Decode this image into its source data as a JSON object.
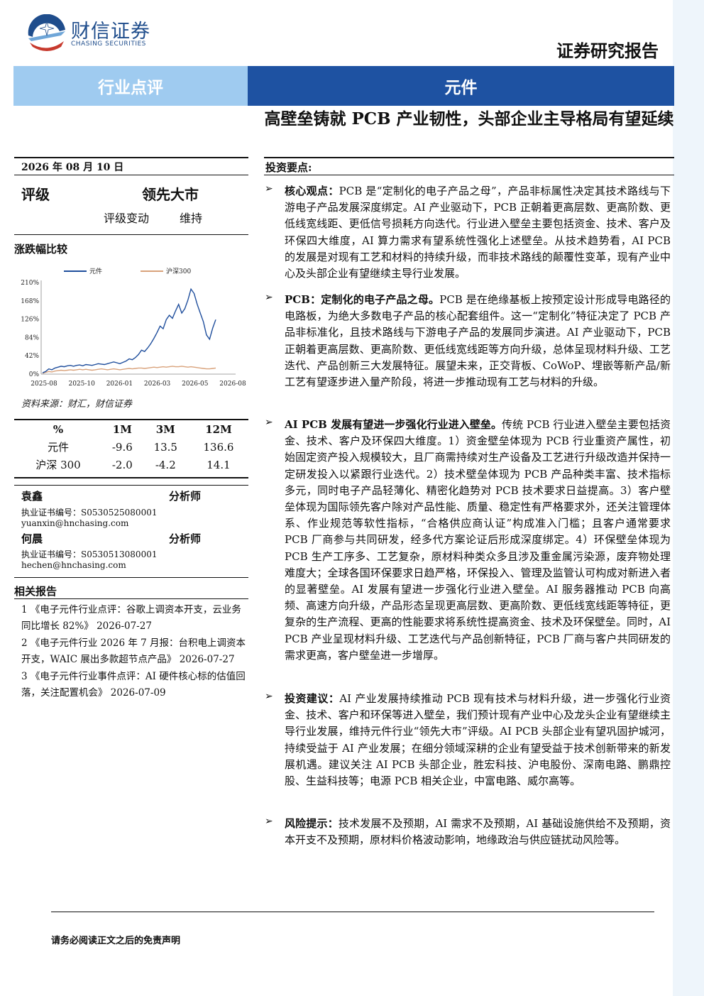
{
  "header": {
    "company_cn": "财信证券",
    "company_en": "CHASING SECURITIES",
    "report_type": "证券研究报告"
  },
  "banner": {
    "category": "行业点评",
    "industry": "元件"
  },
  "title": "高壁垒铸就 PCB 产业韧性，头部企业主导格局有望延续",
  "sidebar": {
    "date": "2026 年 08 月 10 日",
    "rating_label": "评级",
    "rating_value": "领先大市",
    "rating_change_label": "评级变动",
    "rating_change_value": "维持",
    "compare_title": "涨跌幅比较",
    "source": "资料来源：财汇，财信证券",
    "perf_table": {
      "headers": [
        "%",
        "1M",
        "3M",
        "12M"
      ],
      "rows": [
        [
          "元件",
          "-9.6",
          "13.5",
          "136.6"
        ],
        [
          "沪深 300",
          "-2.0",
          "-4.2",
          "14.1"
        ]
      ]
    },
    "analysts": [
      {
        "name": "袁鑫",
        "role": "分析师",
        "cert": "执业证书编号：S0530525080001",
        "email": "yuanxin@hnchasing.com"
      },
      {
        "name": "何晨",
        "role": "分析师",
        "cert": "执业证书编号：S0530513080001",
        "email": "hechen@hnchasing.com"
      }
    ],
    "related_title": "相关报告",
    "related": [
      "1 《电子元件行业点评：谷歌上调资本开支，云业务同比增长 82%》 2026-07-27",
      "2 《电子元件行业 2026 年 7 月报：台积电上调资本开支，WAIC 展出多款超节点产品》 2026-07-27",
      "3 《电子元件行业事件点评：AI 硬件核心标的估值回落，关注配置机会》 2026-07-09"
    ]
  },
  "chart_data": {
    "type": "line",
    "x_ticks": [
      "2025-08",
      "2025-10",
      "2026-01",
      "2026-03",
      "2026-05",
      "2026-08"
    ],
    "y_ticks": [
      "0%",
      "42%",
      "84%",
      "126%",
      "168%",
      "210%"
    ],
    "ylim": [
      0,
      210
    ],
    "grid": false,
    "legend_position": "top",
    "series": [
      {
        "name": "元件",
        "color": "#1f4e9c",
        "values": [
          3,
          6,
          12,
          10,
          14,
          16,
          18,
          17,
          19,
          20,
          18,
          20,
          21,
          19,
          22,
          21,
          20,
          22,
          24,
          23,
          22,
          24,
          26,
          28,
          26,
          24,
          27,
          30,
          35,
          33,
          38,
          45,
          55,
          52,
          60,
          70,
          82,
          95,
          110,
          104,
          125,
          135,
          128,
          145,
          160,
          140,
          150,
          170,
          195,
          185,
          160,
          140,
          120,
          90,
          80,
          105,
          125
        ]
      },
      {
        "name": "沪深300",
        "color": "#d9a27b",
        "values": [
          2,
          4,
          6,
          5,
          7,
          8,
          9,
          8,
          9,
          10,
          9,
          10,
          11,
          10,
          11,
          10,
          9,
          10,
          11,
          12,
          11,
          10,
          11,
          12,
          11,
          10,
          11,
          12,
          13,
          12,
          13,
          14,
          14,
          13,
          14,
          15,
          16,
          15,
          16,
          17,
          16,
          17,
          18,
          17,
          17,
          18,
          17,
          16,
          17,
          16,
          15,
          14,
          13,
          12,
          12,
          13,
          14
        ]
      }
    ]
  },
  "main": {
    "inv_title": "投资要点:",
    "paragraphs": [
      {
        "head": "核心观点：",
        "body": "PCB 是“定制化的电子产品之母”，产品非标属性决定其技术路线与下游电子产品发展深度绑定。AI 产业驱动下，PCB 正朝着更高层数、更高阶数、更低线宽线距、更低信号损耗方向迭代。行业进入壁垒主要包括资金、技术、客户及环保四大维度，AI 算力需求有望系统性强化上述壁垒。从技术趋势看，AI PCB 的发展是对现有工艺和材料的持续升级，而非技术路线的颠覆性变革，现有产业中心及头部企业有望继续主导行业发展。"
      },
      {
        "head": "PCB：定制化的电子产品之母。",
        "body": "PCB 是在绝缘基板上按预定设计形成导电路径的电路板，为绝大多数电子产品的核心配套组件。这一“定制化”特征决定了 PCB 产品非标准化，且技术路线与下游电子产品的发展同步演进。AI 产业驱动下，PCB 正朝着更高层数、更高阶数、更低线宽线距等方向升级，总体呈现材料升级、工艺迭代、产品创新三大发展特征。展望未来，正交背板、CoWoP、埋嵌等新产品/新工艺有望逐步进入量产阶段，将进一步推动现有工艺与材料的升级。"
      },
      {
        "head": "AI PCB 发展有望进一步强化行业进入壁垒。",
        "body": "传统 PCB 行业进入壁垒主要包括资金、技术、客户及环保四大维度。1）资金壁垒体现为 PCB 行业重资产属性，初始固定资产投入规模较大，且厂商需持续对生产设备及工艺进行升级改造并保持一定研发投入以紧跟行业迭代。2）技术壁垒体现为 PCB 产品种类丰富、技术指标多元，同时电子产品轻薄化、精密化趋势对 PCB 技术要求日益提高。3）客户壁垒体现为国际领先客户除对产品性能、质量、稳定性有严格要求外，还关注管理体系、作业规范等软性指标，“合格供应商认证”构成准入门槛；且客户通常要求 PCB 厂商参与共同研发，经多代方案论证后形成深度绑定。4）环保壁垒体现为 PCB 生产工序多、工艺复杂，原材料种类众多且涉及重金属污染源，废弃物处理难度大；全球各国环保要求日趋严格，环保投入、管理及监管认可构成对新进入者的显著壁垒。AI 发展有望进一步强化行业进入壁垒。AI 服务器推动 PCB 向高频、高速方向升级，产品形态呈现更高层数、更高阶数、更低线宽线距等特征，更复杂的生产流程、更高的性能要求将系统性提高资金、技术及环保壁垒。同时，AI PCB 产业呈现材料升级、工艺迭代与产品创新特征，PCB 厂商与客户共同研发的需求更高，客户壁垒进一步增厚。"
      },
      {
        "head": "投资建议：",
        "body": "AI 产业发展持续推动 PCB 现有技术与材料升级，进一步强化行业资金、技术、客户和环保等进入壁垒，我们预计现有产业中心及龙头企业有望继续主导行业发展，维持元件行业“领先大市”评级。AI PCB 头部企业有望巩固护城河，持续受益于 AI 产业发展；在细分领域深耕的企业有望受益于技术创新带来的新发展机遇。建议关注 AI PCB 头部企业，胜宏科技、沪电股份、深南电路、鹏鼎控股、生益科技等；电源 PCB 相关企业，中富电路、威尔高等。"
      },
      {
        "head": "风险提示：",
        "body": "技术发展不及预期，AI 需求不及预期，AI 基础设施供给不及预期，资本开支不及预期，原材料价格波动影响，地缘政治与供应链扰动风险等。"
      }
    ]
  },
  "footer": {
    "disclaimer": "请务必阅读正文之后的免责声明"
  }
}
